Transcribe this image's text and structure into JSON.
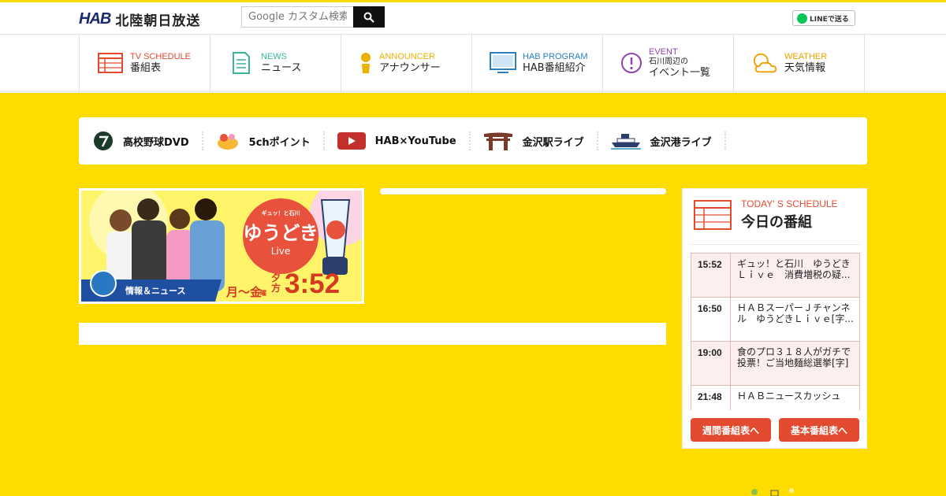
{
  "header": {
    "logo_mark": "HAB",
    "logo_name": "北陸朝日放送",
    "search_placeholder": "Google カスタム検索",
    "line_button": "LINEで送る"
  },
  "nav": [
    {
      "en": "TV SCHEDULE",
      "ja": "番組表",
      "color": "#e24b30",
      "icon": "tv-schedule-icon"
    },
    {
      "en": "NEWS",
      "ja": "ニュース",
      "color": "#3bb39a",
      "icon": "news-icon"
    },
    {
      "en": "ANNOUNCER",
      "ja": "アナウンサー",
      "color": "#e8b200",
      "icon": "announcer-icon"
    },
    {
      "en": "HAB PROGRAM",
      "ja": "HAB番組紹介",
      "color": "#2d7fbf",
      "icon": "tv-monitor-icon"
    },
    {
      "en": "EVENT",
      "ja_small": "石川周辺の",
      "ja": "イベント一覧",
      "color": "#8e44ad",
      "icon": "event-icon"
    },
    {
      "en": "WEATHER",
      "ja": "天気情報",
      "color": "#f0a000",
      "icon": "weather-icon"
    }
  ],
  "quick_links": [
    {
      "label": "高校野球DVD",
      "icon": "baseball-dvd-icon"
    },
    {
      "label": "5chポイント",
      "icon": "point-icon"
    },
    {
      "label": "HAB×YouTube",
      "icon": "youtube-icon"
    },
    {
      "label": "金沢駅ライブ",
      "icon": "kanazawa-station-icon"
    },
    {
      "label": "金沢港ライブ",
      "icon": "kanazawa-port-icon"
    }
  ],
  "banner": {
    "tagline": "ギュッ！と石川",
    "title": "ゆうどき",
    "title_sub": "Live",
    "ribbon": "情報＆ニュース",
    "days": "月～金",
    "days_suffix": "曜",
    "evening": "夕方",
    "time": "3:52"
  },
  "schedule": {
    "title_en": "TODAY' S SCHEDULE",
    "title_ja": "今日の番組",
    "rows": [
      {
        "time": "15:52",
        "program": "ギュッ！と石川　ゆうどきＬｉｖｅ　消費増税の疑..."
      },
      {
        "time": "16:50",
        "program": "ＨＡＢスーパーＪチャンネル　ゆうどきＬｉｖｅ[字..."
      },
      {
        "time": "19:00",
        "program": "食のプロ３１８人がガチで投票！ご当地麺総選挙[字]"
      },
      {
        "time": "21:48",
        "program": "ＨＡＢニュースカッシュ"
      }
    ],
    "weekly_button": "週間番組表へ",
    "basic_button": "基本番組表へ"
  }
}
